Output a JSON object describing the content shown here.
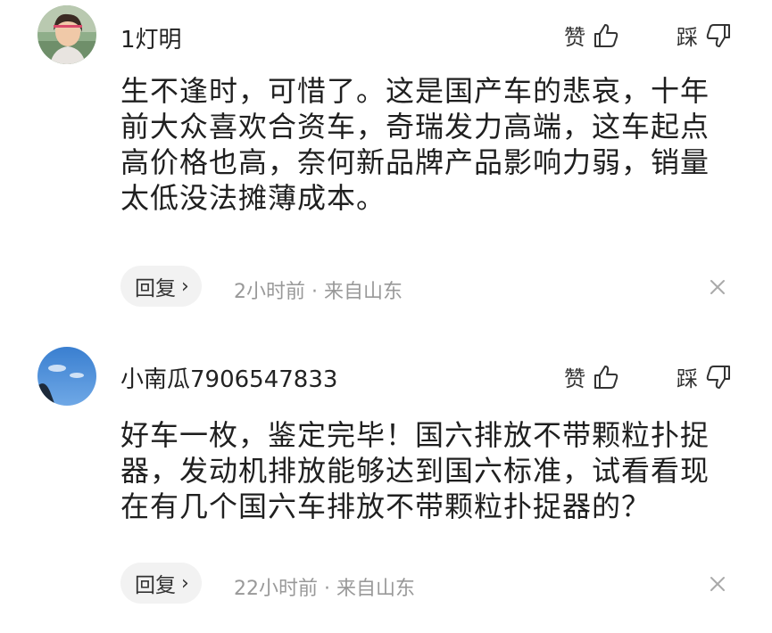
{
  "comments": [
    {
      "username": "1灯明",
      "like_label": "赞",
      "dislike_label": "踩",
      "text_lines": [
        "生不逢时，可惜了。这是国产车的悲哀，十年",
        "前大众喜欢合资车，奇瑞发力高端，这车起点",
        "高价格也高，奈何新品牌产品影响力弱，销量",
        "太低没法摊薄成本。"
      ],
      "reply_label": "回复",
      "meta": "2小时前 · 来自山东"
    },
    {
      "username": "小南瓜7906547833",
      "like_label": "赞",
      "dislike_label": "踩",
      "text_lines": [
        "好车一枚，鉴定完毕！国六排放不带颗粒扑捉",
        "器，发动机排放能够达到国六标准，试看看现",
        "在有几个国六车排放不带颗粒扑捉器的？"
      ],
      "reply_label": "回复",
      "meta": "22小时前 · 来自山东"
    }
  ],
  "icons": {
    "like": "thumbs-up-icon",
    "dislike": "thumbs-down-icon",
    "reply_chevron": "chevron-right-icon",
    "close": "close-icon"
  },
  "colors": {
    "text": "#1f1f1f",
    "meta": "#999999",
    "reply_bg": "#f2f2f2"
  }
}
